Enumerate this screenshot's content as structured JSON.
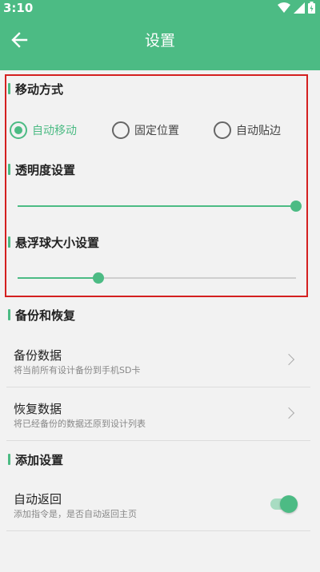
{
  "status_bar": {
    "time": "3:10"
  },
  "header": {
    "title": "设置"
  },
  "move_mode": {
    "heading": "移动方式",
    "options": [
      {
        "label": "自动移动",
        "selected": true
      },
      {
        "label": "固定位置",
        "selected": false
      },
      {
        "label": "自动贴边",
        "selected": false
      }
    ]
  },
  "opacity": {
    "heading": "透明度设置",
    "value_fraction": 1.0
  },
  "ball_size": {
    "heading": "悬浮球大小设置",
    "value_fraction": 0.29
  },
  "backup": {
    "heading": "备份和恢复",
    "items": [
      {
        "title": "备份数据",
        "subtitle": "将当前所有设计备份到手机SD卡"
      },
      {
        "title": "恢复数据",
        "subtitle": "将已经备份的数据还原到设计列表"
      }
    ]
  },
  "add_settings": {
    "heading": "添加设置",
    "auto_return": {
      "title": "自动返回",
      "subtitle": "添加指令是，是否自动返回主页",
      "enabled": true
    }
  },
  "colors": {
    "accent": "#4cbb84",
    "highlight": "#d42020"
  }
}
